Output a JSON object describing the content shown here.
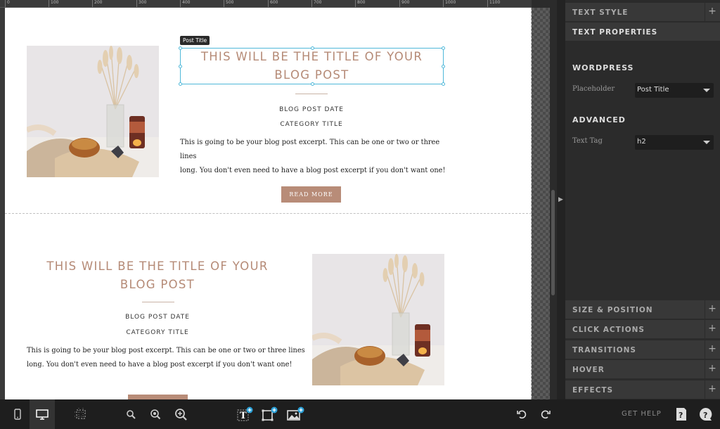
{
  "ruler": {
    "marks": [
      "0",
      "100",
      "200",
      "300",
      "400",
      "500",
      "600",
      "700",
      "800",
      "900",
      "1000",
      "1100"
    ]
  },
  "canvas": {
    "tooltip": "Post Title",
    "post1": {
      "title_line1": "THIS WILL BE THE TITLE OF YOUR",
      "title_line2": "BLOG POST",
      "date": "BLOG POST DATE",
      "category": "CATEGORY TITLE",
      "excerpt_line1": "This is going to be your blog post excerpt. This can be one or two or three lines",
      "excerpt_line2": "long. You don't even need to have a blog post excerpt if you don't want one!",
      "button": "READ MORE"
    },
    "post2": {
      "title_line1": "THIS WILL BE THE TITLE OF YOUR",
      "title_line2": "BLOG POST",
      "date": "BLOG POST DATE",
      "category": "CATEGORY TITLE",
      "excerpt_line1": "This is going to be your blog post excerpt. This can be one or two or three lines",
      "excerpt_line2": "long. You don't even need to have a blog post excerpt if you don't want one!"
    }
  },
  "panel": {
    "text_style": "TEXT STYLE",
    "text_properties": "TEXT PROPERTIES",
    "wordpress": "WORDPRESS",
    "placeholder_label": "Placeholder",
    "placeholder_value": "Post Title",
    "advanced": "ADVANCED",
    "text_tag_label": "Text Tag",
    "text_tag_value": "h2",
    "size_position": "SIZE & POSITION",
    "click_actions": "CLICK ACTIONS",
    "transitions": "TRANSITIONS",
    "hover": "HOVER",
    "effects": "EFFECTS",
    "plus": "+"
  },
  "toolbar": {
    "get_help": "GET HELP"
  },
  "colors": {
    "accent": "#b88c78",
    "selection": "#4fb8d9",
    "panel_bg": "#2b2b2b"
  }
}
